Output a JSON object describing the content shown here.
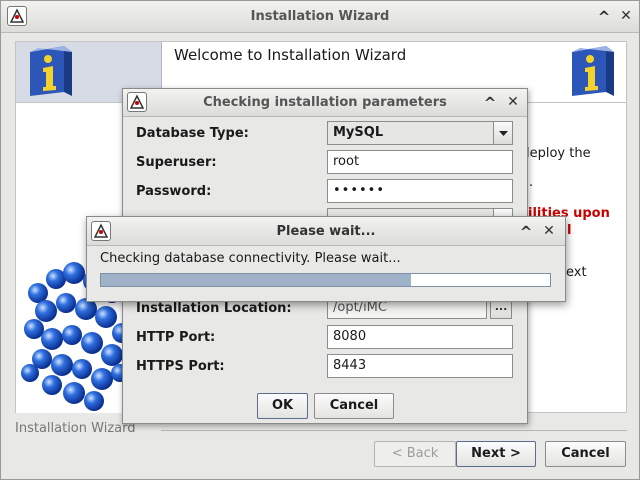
{
  "main": {
    "title": "Installation Wizard",
    "banner_title": "Welcome to Installation Wizard",
    "background_text": {
      "line1": "leploy the",
      "line2": ".",
      "warning1": "ilities upon",
      "warning2": "l",
      "line3": "ext"
    },
    "footer_label": "Installation Wizard",
    "buttons": {
      "back": "< Back",
      "next": "Next >",
      "cancel": "Cancel"
    }
  },
  "params_dialog": {
    "title": "Checking installation parameters",
    "fields": {
      "database_type": {
        "label": "Database Type:",
        "value": "MySQL"
      },
      "superuser": {
        "label": "Superuser:",
        "value": "root"
      },
      "password": {
        "label": "Password:",
        "value": "••••••"
      },
      "install_location": {
        "label": "Installation Location:",
        "value": "/opt/iMC"
      },
      "http_port": {
        "label": "HTTP Port:",
        "value": "8080"
      },
      "https_port": {
        "label": "HTTPS Port:",
        "value": "8443"
      }
    },
    "browse_label": "...",
    "ok_label": "OK",
    "cancel_label": "Cancel"
  },
  "wait_dialog": {
    "title": "Please wait...",
    "message": "Checking database connectivity. Please wait...",
    "progress": 0.69
  },
  "window_controls": {
    "minimize": "^",
    "close": "✕"
  },
  "colors": {
    "accent": "#a0b2c8",
    "warning": "#cc0000"
  }
}
